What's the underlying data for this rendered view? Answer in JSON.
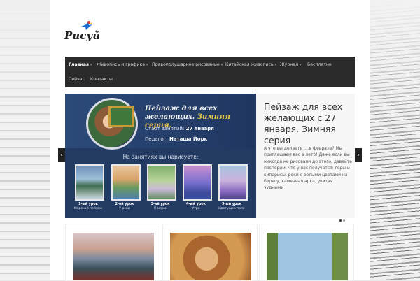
{
  "logo": {
    "text": "Рисуй"
  },
  "nav": [
    {
      "label": "Главная",
      "active": true
    },
    {
      "label": "Живопись и графика",
      "dropdown": true
    },
    {
      "label": "Правополушарное рисование",
      "dropdown": true
    },
    {
      "label": "Китайская живопись",
      "dropdown": true
    },
    {
      "label": "Журнал",
      "dropdown": true
    },
    {
      "label": "Бесплатно"
    },
    {
      "label": "Сейчас"
    },
    {
      "label": "Контакты"
    }
  ],
  "nav_caret": "▾",
  "slide": {
    "banner_title_1": "Пейзаж для всех",
    "banner_title_2": "желающих.",
    "banner_title_hl": "Зимняя серия.",
    "start_label": "Старт занятий:",
    "start_value": "27 января",
    "teacher_label": "Педагог:",
    "teacher_value": "Наташа Йорк",
    "subtitle": "На занятиях вы нарисуете:",
    "lessons": [
      {
        "num": "1-ый урок",
        "name": "Морской пейзаж"
      },
      {
        "num": "2-ой урок",
        "name": "У реки"
      },
      {
        "num": "3-ий урок",
        "name": "К морю"
      },
      {
        "num": "4-ый урок",
        "name": "Утро"
      },
      {
        "num": "5-ый урок",
        "name": "Цветущее поле"
      }
    ],
    "heading": "Пейзаж для всех желающих с 27 января. Зимняя серия",
    "body": "А что вы делаете ....в феврале? Мы приглашаем вас в лето! Даже если вы никогда не рисовали до этого, давайте поспорим, что у вас получатся: горы и кипарисы, реки с белыми цветами на берегу, каменная арка, увитая чудными"
  },
  "arrows": {
    "prev": "‹",
    "next": "›"
  },
  "colors": {
    "nav_bg": "#2a2a2a",
    "banner_bg": "#233b63",
    "accent": "#e9c94a"
  }
}
